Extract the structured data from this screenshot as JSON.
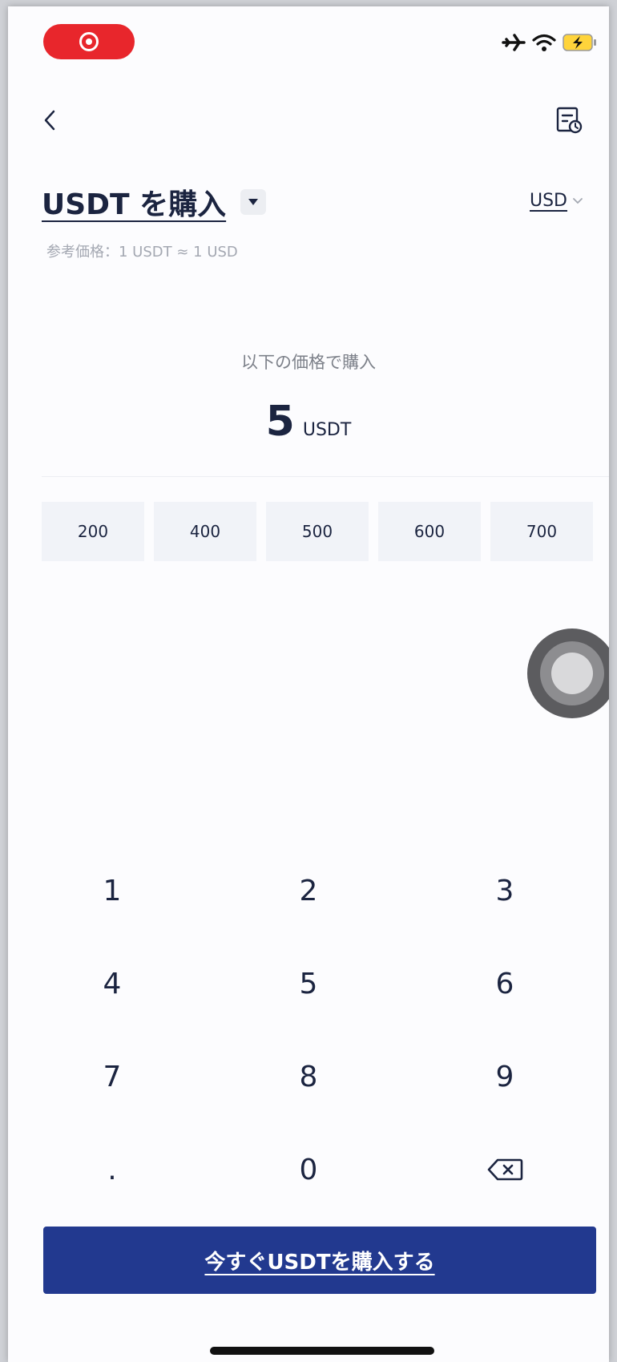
{
  "status_bar": {
    "recording_icon": "record-icon",
    "airplane_icon": "airplane-icon",
    "wifi_icon": "wifi-icon",
    "battery_icon": "battery-charging-icon"
  },
  "header": {
    "back_icon": "chevron-left-icon",
    "orders_icon": "order-history-icon"
  },
  "title": {
    "text": "USDT を購入",
    "dropdown_icon": "caret-down-icon"
  },
  "currency_selector": {
    "value": "USD",
    "icon": "chevron-down-icon"
  },
  "reference_price": "参考価格：1 USDT ≈ 1 USD",
  "amount": {
    "caption": "以下の価格で購入",
    "value": "5",
    "unit": "USDT"
  },
  "presets": [
    "200",
    "400",
    "500",
    "600",
    "700"
  ],
  "keypad": {
    "keys": [
      "1",
      "2",
      "3",
      "4",
      "5",
      "6",
      "7",
      "8",
      "9",
      ".",
      "0"
    ],
    "delete_icon": "backspace-icon"
  },
  "buy_button": {
    "label": "今すぐUSDTを購入する"
  },
  "colors": {
    "primary": "#22398f",
    "text": "#1b2440",
    "muted": "#a4a8b2",
    "preset_bg": "#f1f3f8",
    "recording": "#e8262c"
  }
}
